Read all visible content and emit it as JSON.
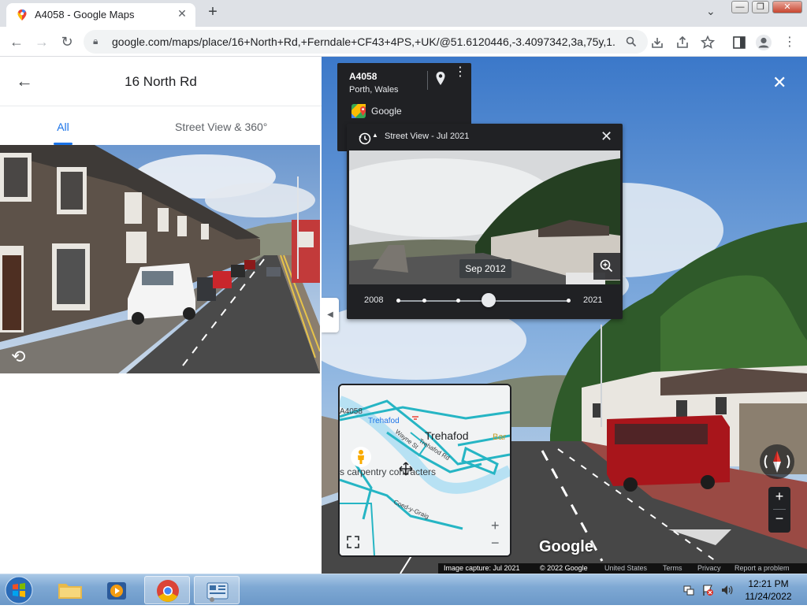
{
  "browser": {
    "tab_title": "A4058 - Google Maps",
    "tab_close": "✕",
    "new_tab": "+",
    "tab_menu": "⌄",
    "url": "google.com/maps/place/16+North+Rd,+Ferndale+CF43+4PS,+UK/@51.6120446,-3.4097342,3a,75y,1...",
    "window_controls": {
      "minimize": "—",
      "restore": "❐",
      "close": "✕"
    }
  },
  "left_panel": {
    "title": "16 North Rd",
    "tabs": [
      {
        "label": "All",
        "active": true
      },
      {
        "label": "Street View & 360°",
        "active": false
      }
    ]
  },
  "street_view": {
    "info_card": {
      "road": "A4058",
      "region": "Porth, Wales",
      "source": "Google"
    },
    "time_machine": {
      "title": "Street View - Jul 2021",
      "tooltip": "Sep 2012",
      "year_start": "2008",
      "year_end": "2021",
      "selected_fraction": 0.53
    },
    "minimap": {
      "labels": {
        "road": "A4058",
        "station": "Trehafod",
        "village": "Trehafod",
        "partial": "Bar",
        "street_1": "Wayne St",
        "street_2": "Trehafod Rd",
        "business": "s carpentry contracters",
        "street_3": "Coed-y-Graig"
      },
      "zoom_in": "+",
      "zoom_out": "−"
    },
    "logo": "Google",
    "zoom_in": "+",
    "zoom_out": "−",
    "close": "✕",
    "attribution": {
      "capture": "Image capture: Jul 2021",
      "copyright": "© 2022 Google",
      "country": "United States",
      "terms": "Terms",
      "privacy": "Privacy",
      "report": "Report a problem"
    }
  },
  "taskbar": {
    "time": "12:21 PM",
    "date": "11/24/2022"
  },
  "colors": {
    "accent": "#1a73e8",
    "dark_panel": "#202124",
    "taskbar": "#7fa9d4"
  }
}
